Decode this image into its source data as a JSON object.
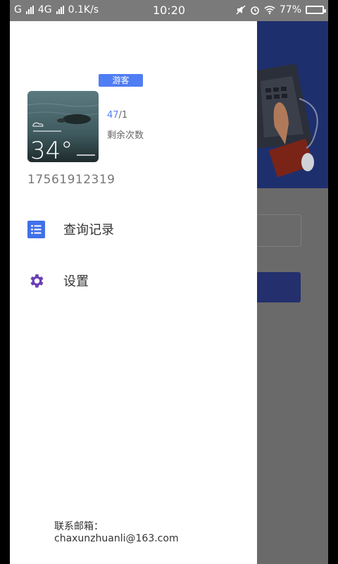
{
  "status_bar": {
    "carrier_1": "G",
    "carrier_2": "4G",
    "net_speed": "0.1K/s",
    "time": "10:20",
    "battery": "77%"
  },
  "drawer": {
    "badge": "游客",
    "count_value": "47",
    "count_total": "/1",
    "remaining_label": "剩余次数",
    "phone": "17561912319",
    "menu": [
      {
        "label": "查询记录",
        "icon": "list-icon"
      },
      {
        "label": "设置",
        "icon": "gear-icon"
      }
    ],
    "contact_label": "联系邮箱：",
    "contact_email": "chaxunzhuanli@163.com"
  },
  "avatar_widget": {
    "temperature": "34°"
  },
  "colors": {
    "accent": "#4f7df3",
    "menu_icon_blue": "#4170e8",
    "settings_icon_purple": "#6a3fb5",
    "scrim": "#6a6a6a"
  }
}
